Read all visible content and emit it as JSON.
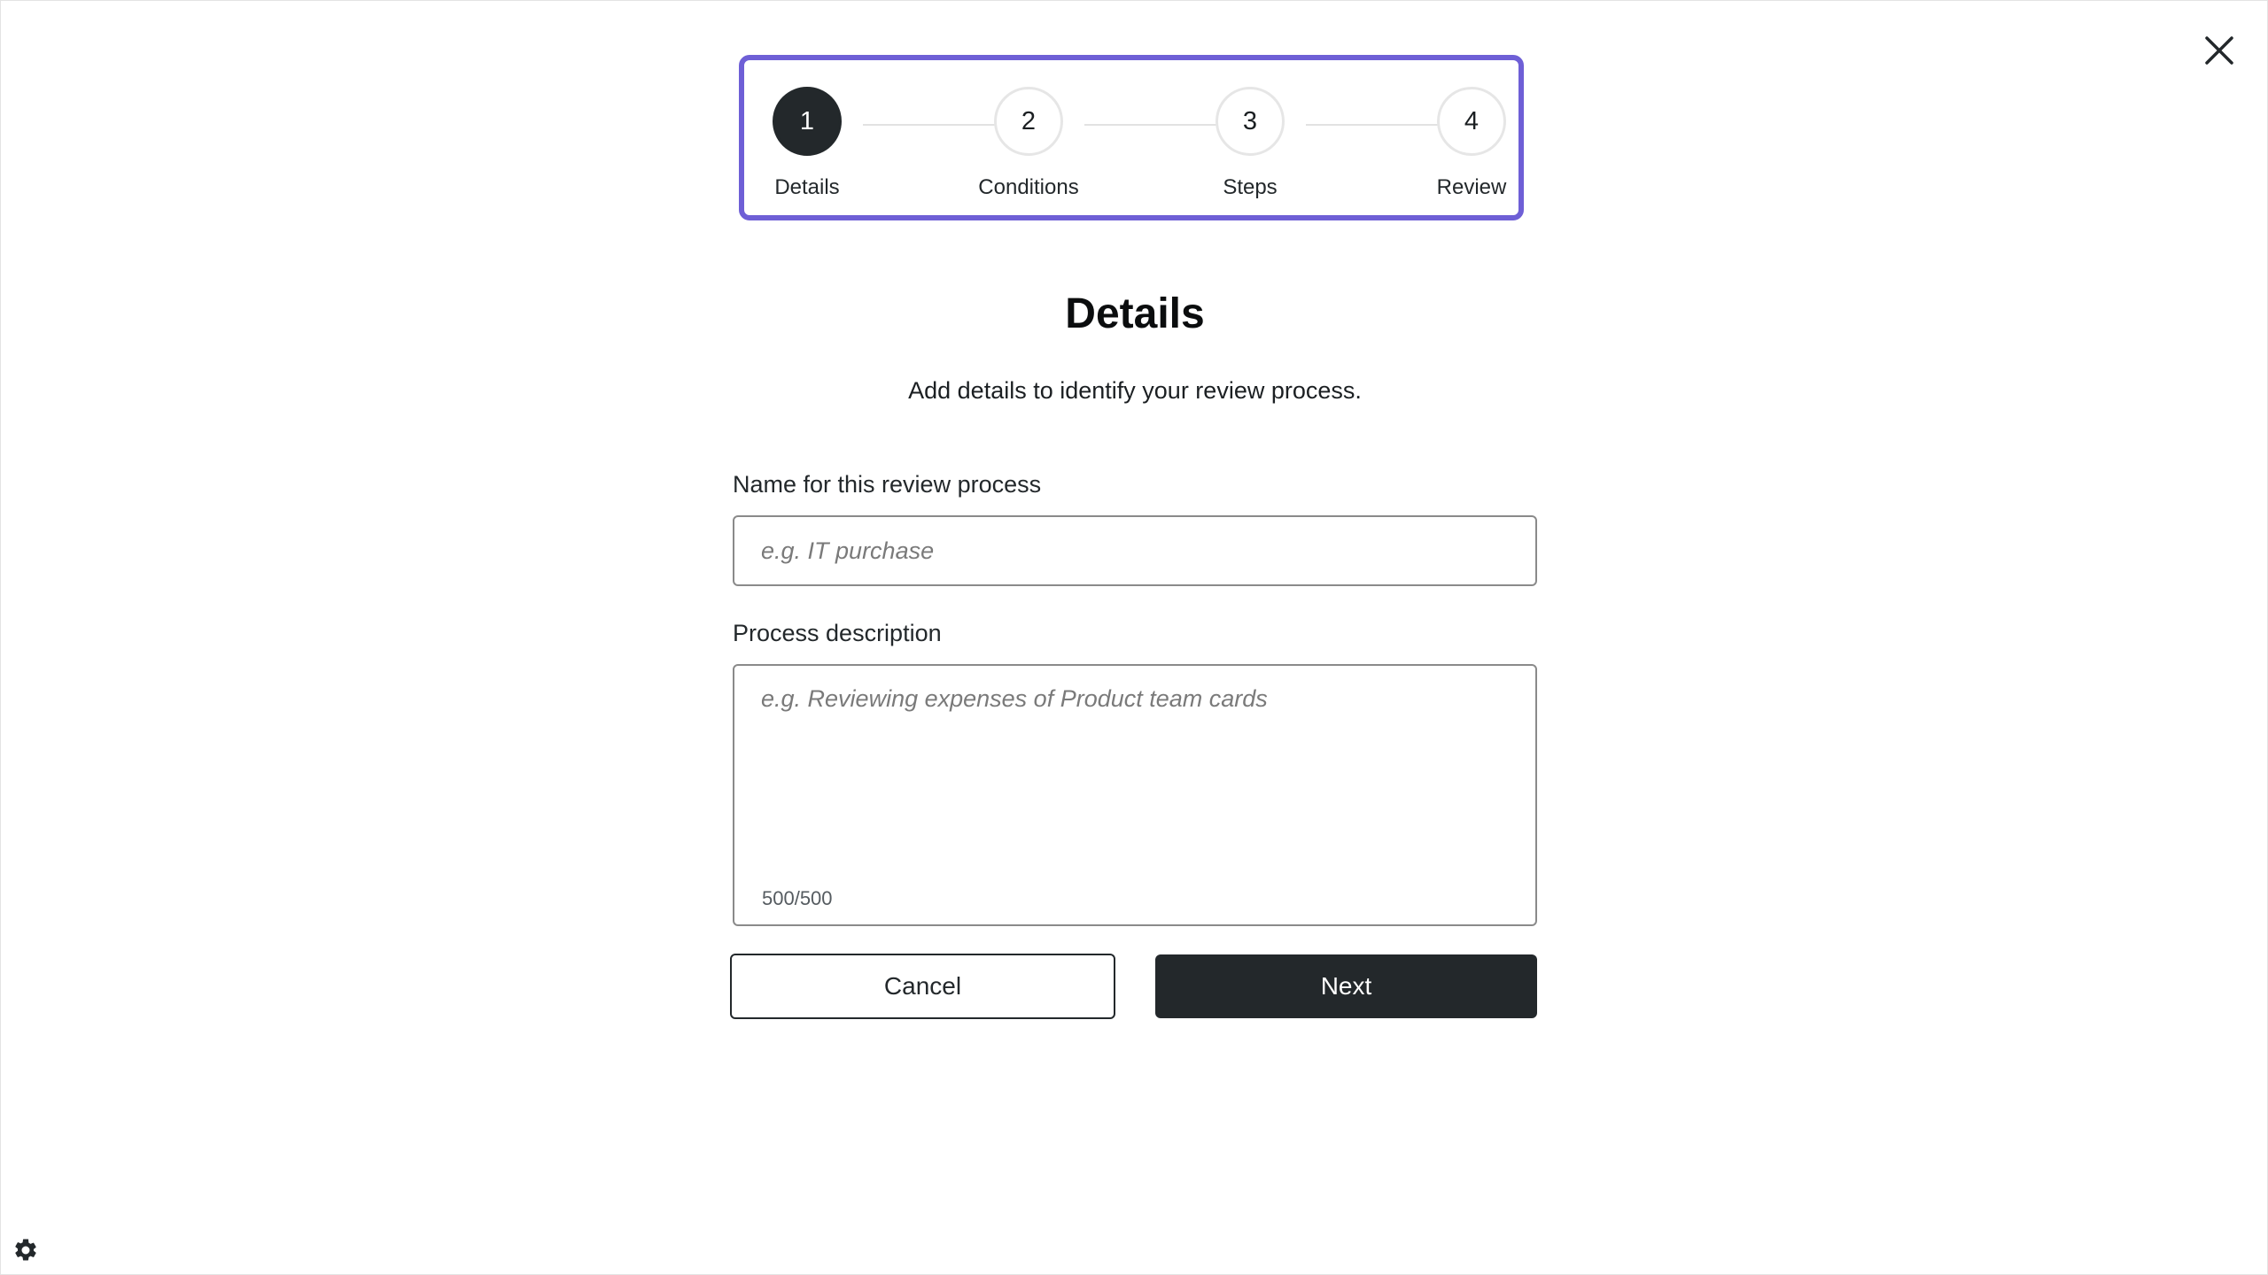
{
  "stepper": {
    "steps": [
      {
        "number": "1",
        "label": "Details",
        "active": true
      },
      {
        "number": "2",
        "label": "Conditions",
        "active": false
      },
      {
        "number": "3",
        "label": "Steps",
        "active": false
      },
      {
        "number": "4",
        "label": "Review",
        "active": false
      }
    ],
    "accent_color": "#6e5fd6"
  },
  "page": {
    "title": "Details",
    "subtitle": "Add details to identify your review process."
  },
  "form": {
    "name_label": "Name for this review process",
    "name_placeholder": "e.g. IT purchase",
    "name_value": "",
    "description_label": "Process description",
    "description_placeholder": "e.g. Reviewing expenses of Product team cards",
    "description_value": "",
    "char_count": "500/500"
  },
  "actions": {
    "cancel_label": "Cancel",
    "next_label": "Next"
  },
  "icons": {
    "close": "close-icon",
    "settings": "gear-icon"
  }
}
